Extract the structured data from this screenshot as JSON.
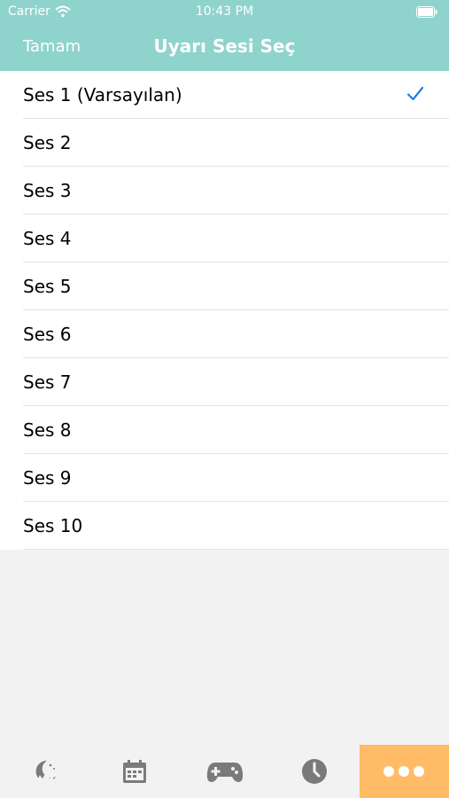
{
  "status_bar": {
    "carrier": "Carrier",
    "time": "10:43 PM",
    "wifi_icon": "wifi-icon",
    "battery_icon": "battery-icon"
  },
  "nav": {
    "done_label": "Tamam",
    "title": "Uyarı Sesi Seç"
  },
  "sounds": [
    {
      "label": "Ses 1 (Varsayılan)",
      "selected": true
    },
    {
      "label": "Ses 2",
      "selected": false
    },
    {
      "label": "Ses 3",
      "selected": false
    },
    {
      "label": "Ses 4",
      "selected": false
    },
    {
      "label": "Ses 5",
      "selected": false
    },
    {
      "label": "Ses 6",
      "selected": false
    },
    {
      "label": "Ses 7",
      "selected": false
    },
    {
      "label": "Ses 8",
      "selected": false
    },
    {
      "label": "Ses 9",
      "selected": false
    },
    {
      "label": "Ses 10",
      "selected": false
    }
  ],
  "tabs": [
    {
      "icon": "night-moon-icon",
      "active": false
    },
    {
      "icon": "calendar-icon",
      "active": false
    },
    {
      "icon": "gamepad-icon",
      "active": false
    },
    {
      "icon": "clock-icon",
      "active": false
    },
    {
      "icon": "more-dots-icon",
      "active": true
    }
  ],
  "colors": {
    "header": "#8fd3cd",
    "check": "#1a7fe6",
    "active_tab": "#ffbb66",
    "tab_icon": "#7a7a7a"
  }
}
